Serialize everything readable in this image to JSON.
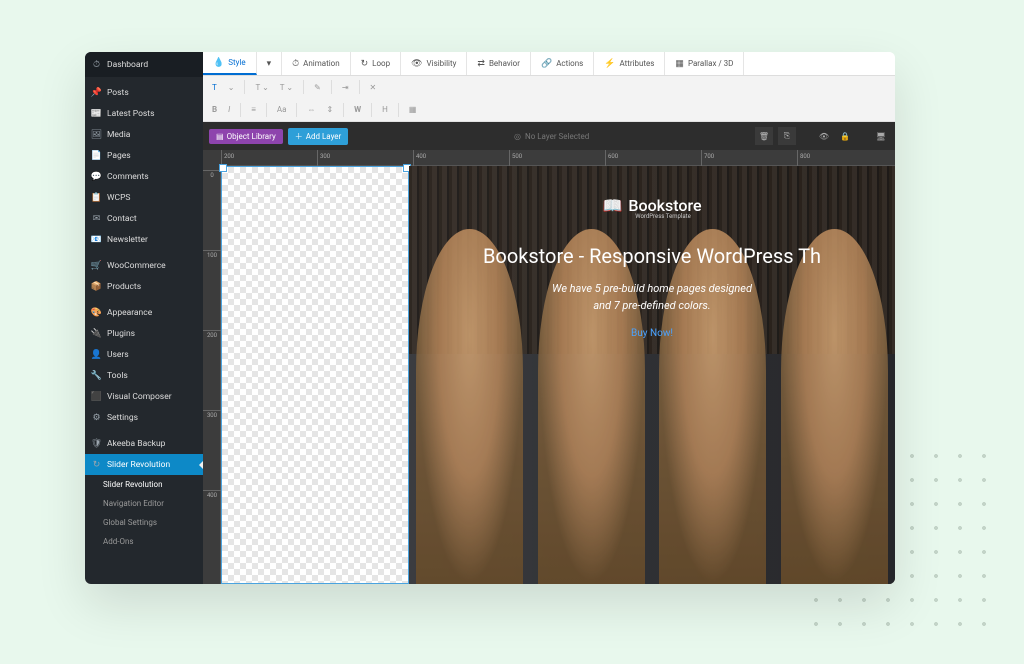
{
  "sidebar": {
    "dashboard": "Dashboard",
    "items": [
      {
        "icon": "📌",
        "label": "Posts"
      },
      {
        "icon": "📰",
        "label": "Latest Posts"
      },
      {
        "icon": "🖼",
        "label": "Media"
      },
      {
        "icon": "📄",
        "label": "Pages"
      },
      {
        "icon": "💬",
        "label": "Comments"
      },
      {
        "icon": "📋",
        "label": "WCPS"
      },
      {
        "icon": "✉",
        "label": "Contact"
      },
      {
        "icon": "📧",
        "label": "Newsletter"
      }
    ],
    "items2": [
      {
        "icon": "🛒",
        "label": "WooCommerce"
      },
      {
        "icon": "📦",
        "label": "Products"
      }
    ],
    "items3": [
      {
        "icon": "🎨",
        "label": "Appearance"
      },
      {
        "icon": "🔌",
        "label": "Plugins"
      },
      {
        "icon": "👤",
        "label": "Users"
      },
      {
        "icon": "🔧",
        "label": "Tools"
      },
      {
        "icon": "⬛",
        "label": "Visual Composer"
      },
      {
        "icon": "⚙",
        "label": "Settings"
      }
    ],
    "items4": [
      {
        "icon": "🛡",
        "label": "Akeeba Backup"
      },
      {
        "icon": "↻",
        "label": "Slider Revolution"
      }
    ],
    "subs": [
      {
        "label": "Slider Revolution",
        "curr": true
      },
      {
        "label": "Navigation Editor"
      },
      {
        "label": "Global Settings"
      },
      {
        "label": "Add-Ons"
      }
    ]
  },
  "tabs": [
    {
      "icon": "💧",
      "label": "Style",
      "active": true
    },
    {
      "icon": "▾",
      "label": ""
    },
    {
      "icon": "⏱",
      "label": "Animation"
    },
    {
      "icon": "↻",
      "label": "Loop"
    },
    {
      "icon": "👁",
      "label": "Visibility"
    },
    {
      "icon": "⇄",
      "label": "Behavior"
    },
    {
      "icon": "🔗",
      "label": "Actions"
    },
    {
      "icon": "⚡",
      "label": "Attributes"
    },
    {
      "icon": "▦",
      "label": "Parallax / 3D"
    }
  ],
  "actionbar": {
    "object_library": "Object Library",
    "add_layer": "Add Layer",
    "no_layer": "No Layer Selected"
  },
  "slide": {
    "logo_text": "Bookstore",
    "logo_sub": "WordPress Template",
    "headline": "Bookstore - Responsive WordPress Th",
    "sub1": "We have 5 pre-build home pages designed",
    "sub2": "and 7 pre-defined colors.",
    "cta": "Buy Now!"
  },
  "ruler_h": [
    "200",
    "300",
    "400",
    "500",
    "600",
    "700",
    "800"
  ],
  "ruler_v": [
    "0",
    "100",
    "200",
    "300",
    "400"
  ]
}
